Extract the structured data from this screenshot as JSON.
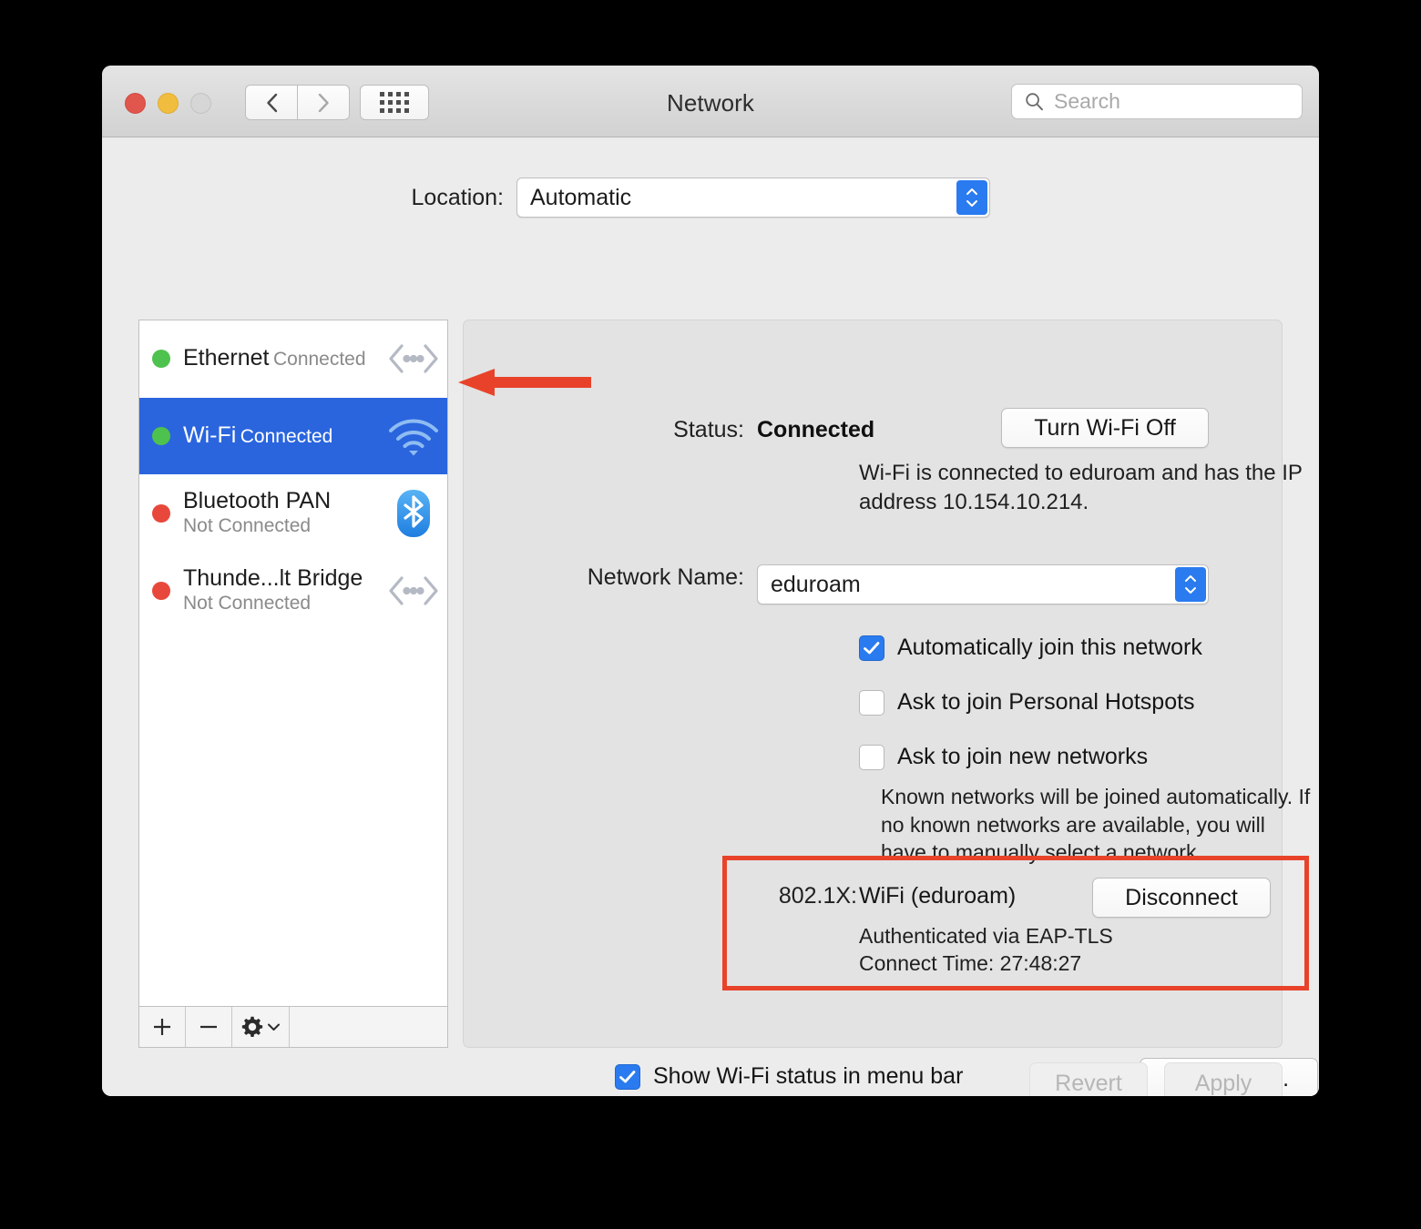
{
  "window": {
    "title": "Network",
    "traffic_lights": [
      "close",
      "minimize",
      "zoom"
    ],
    "nav": {
      "back": "back-arrow",
      "forward": "forward-arrow",
      "grid": "show-all-grid"
    }
  },
  "search": {
    "placeholder": "Search",
    "value": "",
    "icon": "search-icon"
  },
  "location": {
    "label": "Location:",
    "value": "Automatic",
    "options": [
      "Automatic"
    ]
  },
  "sidebar": {
    "services": [
      {
        "name": "Ethernet",
        "status": "Connected",
        "dot": "green",
        "icon": "ethernet-icon",
        "selected": false
      },
      {
        "name": "Wi-Fi",
        "status": "Connected",
        "dot": "green",
        "icon": "wifi-icon",
        "selected": true
      },
      {
        "name": "Bluetooth PAN",
        "status": "Not Connected",
        "dot": "red",
        "icon": "bluetooth-icon",
        "selected": false
      },
      {
        "name": "Thunde...lt Bridge",
        "status": "Not Connected",
        "dot": "red",
        "icon": "ethernet-icon",
        "selected": false
      }
    ],
    "toolbar": {
      "add": "+",
      "remove": "−",
      "actions": "gear-icon"
    }
  },
  "panel": {
    "status_label": "Status:",
    "status_value": "Connected",
    "turn_off_button": "Turn Wi-Fi Off",
    "status_description": "Wi-Fi is connected to eduroam and has the IP address 10.154.10.214.",
    "network_name_label": "Network Name:",
    "network_name_value": "eduroam",
    "checkboxes": [
      {
        "label": "Automatically join this network",
        "checked": true
      },
      {
        "label": "Ask to join Personal Hotspots",
        "checked": false
      },
      {
        "label": "Ask to join new networks",
        "checked": false
      }
    ],
    "help_text": "Known networks will be joined automatically. If no known networks are available, you will have to manually select a network.",
    "dot1x": {
      "label": "802.1X:",
      "value": "WiFi (eduroam)",
      "disconnect_button": "Disconnect",
      "auth_line": "Authenticated via EAP-TLS",
      "time_line": "Connect Time: 27:48:27"
    },
    "menubar_checkbox": {
      "label": "Show Wi-Fi status in menu bar",
      "checked": true
    },
    "advanced_button": "Advanced...",
    "help_button": "?"
  },
  "footer": {
    "revert_button": "Revert",
    "apply_button": "Apply",
    "revert_enabled": false,
    "apply_enabled": false
  },
  "annotations": {
    "arrow": {
      "target": "wifi-sidebar-row",
      "direction": "left",
      "color": "#e8432a"
    },
    "highlight_rect": {
      "target": "802.1X section",
      "color": "#e8432a"
    }
  },
  "colors": {
    "accent_blue": "#2a65de",
    "control_blue": "#2a7bf0",
    "annotation_red": "#e8432a",
    "status_green": "#4ec24e",
    "status_red": "#e8483b",
    "window_bg": "#ececec",
    "panel_bg": "#e3e3e3"
  }
}
